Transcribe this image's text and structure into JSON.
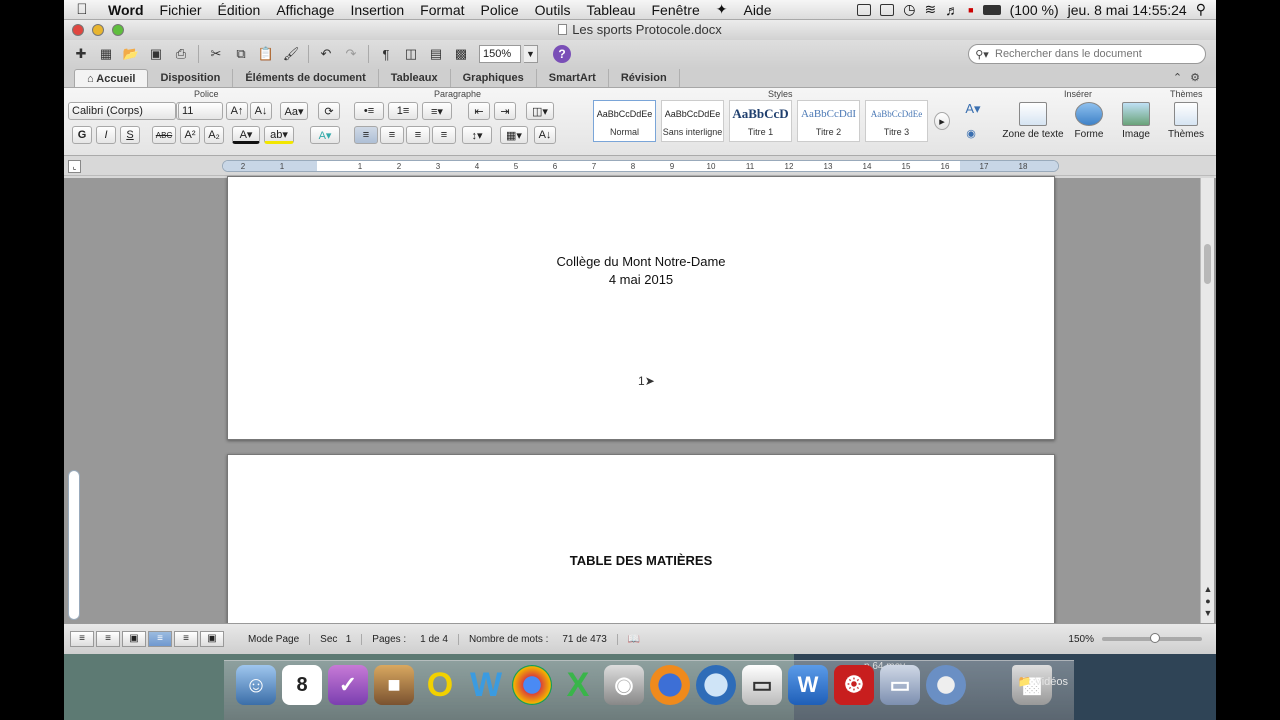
{
  "menubar": {
    "app": "Word",
    "items": [
      "Fichier",
      "Édition",
      "Affichage",
      "Insertion",
      "Format",
      "Police",
      "Outils",
      "Tableau",
      "Fenêtre",
      "Aide"
    ],
    "battery": "(100 %)",
    "clock": "jeu. 8 mai  14:55:24"
  },
  "window": {
    "title": "Les sports Protocole.docx"
  },
  "toolbar": {
    "zoom": "150%",
    "search_placeholder": "Rechercher dans le document"
  },
  "ribbon": {
    "tabs": [
      "Accueil",
      "Disposition",
      "Éléments de document",
      "Tableaux",
      "Graphiques",
      "SmartArt",
      "Révision"
    ],
    "active_tab": "Accueil",
    "groups": {
      "police": "Police",
      "paragraphe": "Paragraphe",
      "styles": "Styles",
      "inserer": "Insérer",
      "themes": "Thèmes"
    },
    "font_name": "Calibri (Corps)",
    "font_size": "11",
    "format_buttons": [
      "G",
      "I",
      "S",
      "ABC",
      "A²",
      "A₂"
    ],
    "styles": [
      {
        "sample": "AaBbCcDdEe",
        "label": "Normal"
      },
      {
        "sample": "AaBbCcDdEe",
        "label": "Sans interligne"
      },
      {
        "sample": "AaBbCcD",
        "label": "Titre 1"
      },
      {
        "sample": "AaBbCcDdI",
        "label": "Titre 2"
      },
      {
        "sample": "AaBbCcDdEe",
        "label": "Titre 3"
      }
    ],
    "insert": [
      {
        "label": "Zone de texte"
      },
      {
        "label": "Forme"
      },
      {
        "label": "Image"
      },
      {
        "label": "Thèmes"
      }
    ]
  },
  "ruler": {
    "numbers": [
      "2",
      "1",
      "1",
      "2",
      "3",
      "4",
      "5",
      "6",
      "7",
      "8",
      "9",
      "10",
      "11",
      "12",
      "13",
      "14",
      "15",
      "16",
      "17",
      "18"
    ]
  },
  "document": {
    "page1": {
      "line1": "Collège du Mont Notre-Dame",
      "line2": "4 mai 2015",
      "page_number": "1"
    },
    "page2": {
      "heading": "TABLE DES MATIÈRES"
    }
  },
  "statusbar": {
    "mode": "Mode Page",
    "section_label": "Sec",
    "section_value": "1",
    "pages_label": "Pages :",
    "pages_value": "1 de 4",
    "words_label": "Nombre de mots :",
    "words_value": "71 de 473",
    "zoom": "150%"
  },
  "dock": {
    "movie_label": "n 64.mov",
    "folder_label": "Vidéos",
    "calendar_day": "8"
  },
  "colors": {
    "accent": "#6f98cf",
    "desktop": "#5d7a73"
  }
}
